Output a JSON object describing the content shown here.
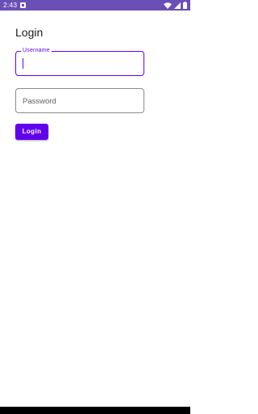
{
  "status_bar": {
    "time": "2:43",
    "notification_icon": "notification-icon",
    "wifi_icon": "wifi-icon",
    "signal_icon": "signal-icon",
    "battery_icon": "battery-icon",
    "background_color": "#6a4fb6"
  },
  "page": {
    "title": "Login"
  },
  "form": {
    "username": {
      "label": "Username",
      "value": ""
    },
    "password": {
      "placeholder": "Password",
      "value": ""
    },
    "login_button_label": "Login"
  },
  "colors": {
    "accent": "#6200ee",
    "title_text": "#1c1b1f",
    "field_border": "#8a8a8a"
  }
}
